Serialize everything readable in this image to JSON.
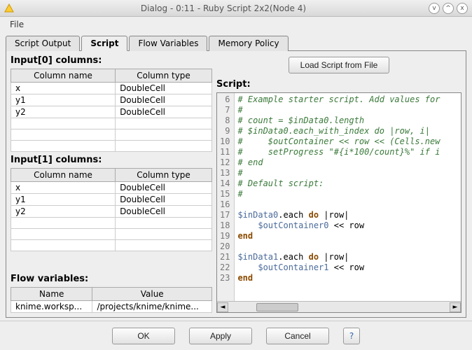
{
  "window": {
    "title": "Dialog - 0:11 - Ruby Script 2x2(Node 4)",
    "menu": {
      "file": "File"
    },
    "buttons": {
      "min": "v",
      "max": "^",
      "close": "x"
    }
  },
  "tabs": {
    "script_output": "Script Output",
    "script": "Script",
    "flow_variables": "Flow Variables",
    "memory_policy": "Memory Policy"
  },
  "left": {
    "input0_label": "Input[0] columns:",
    "input1_label": "Input[1] columns:",
    "flow_label": "Flow variables:",
    "col_name_hdr": "Column name",
    "col_type_hdr": "Column type",
    "name_hdr": "Name",
    "value_hdr": "Value",
    "input0": [
      {
        "name": "x",
        "type": "DoubleCell"
      },
      {
        "name": "y1",
        "type": "DoubleCell"
      },
      {
        "name": "y2",
        "type": "DoubleCell"
      }
    ],
    "input1": [
      {
        "name": "x",
        "type": "DoubleCell"
      },
      {
        "name": "y1",
        "type": "DoubleCell"
      },
      {
        "name": "y2",
        "type": "DoubleCell"
      }
    ],
    "flow": [
      {
        "name": "knime.worksp...",
        "value": "/projects/knime/knime..."
      }
    ]
  },
  "right": {
    "load_btn": "Load Script from File",
    "script_label": "Script:"
  },
  "code": {
    "lines": [
      {
        "n": "6",
        "cls": "c-comment",
        "t": "# Example starter script. Add values for"
      },
      {
        "n": "7",
        "cls": "c-comment",
        "t": "#"
      },
      {
        "n": "8",
        "cls": "c-comment",
        "t": "# count = $inData0.length"
      },
      {
        "n": "9",
        "cls": "c-comment",
        "t": "# $inData0.each_with_index do |row, i|"
      },
      {
        "n": "10",
        "cls": "c-comment",
        "t": "#     $outContainer << row << (Cells.new"
      },
      {
        "n": "11",
        "cls": "c-comment",
        "t": "#     setProgress \"#{i*100/count}%\" if i"
      },
      {
        "n": "12",
        "cls": "c-comment",
        "t": "# end"
      },
      {
        "n": "13",
        "cls": "c-comment",
        "t": "#"
      },
      {
        "n": "14",
        "cls": "c-comment",
        "t": "# Default script:"
      },
      {
        "n": "15",
        "cls": "c-comment",
        "t": "#"
      },
      {
        "n": "16",
        "cls": "",
        "t": ""
      },
      {
        "n": "17",
        "cls": "",
        "html": "<span class='c-var'>$inData0</span>.each <span class='c-kw'>do</span> |row|"
      },
      {
        "n": "18",
        "cls": "",
        "html": "    <span class='c-var'>$outContainer0</span> &lt;&lt; row"
      },
      {
        "n": "19",
        "cls": "c-kw",
        "t": "end"
      },
      {
        "n": "20",
        "cls": "",
        "t": ""
      },
      {
        "n": "21",
        "cls": "",
        "html": "<span class='c-var'>$inData1</span>.each <span class='c-kw'>do</span> |row|"
      },
      {
        "n": "22",
        "cls": "",
        "html": "    <span class='c-var'>$outContainer1</span> &lt;&lt; row"
      },
      {
        "n": "23",
        "cls": "c-kw",
        "t": "end"
      }
    ]
  },
  "buttons": {
    "ok": "OK",
    "apply": "Apply",
    "cancel": "Cancel",
    "help": "?"
  }
}
